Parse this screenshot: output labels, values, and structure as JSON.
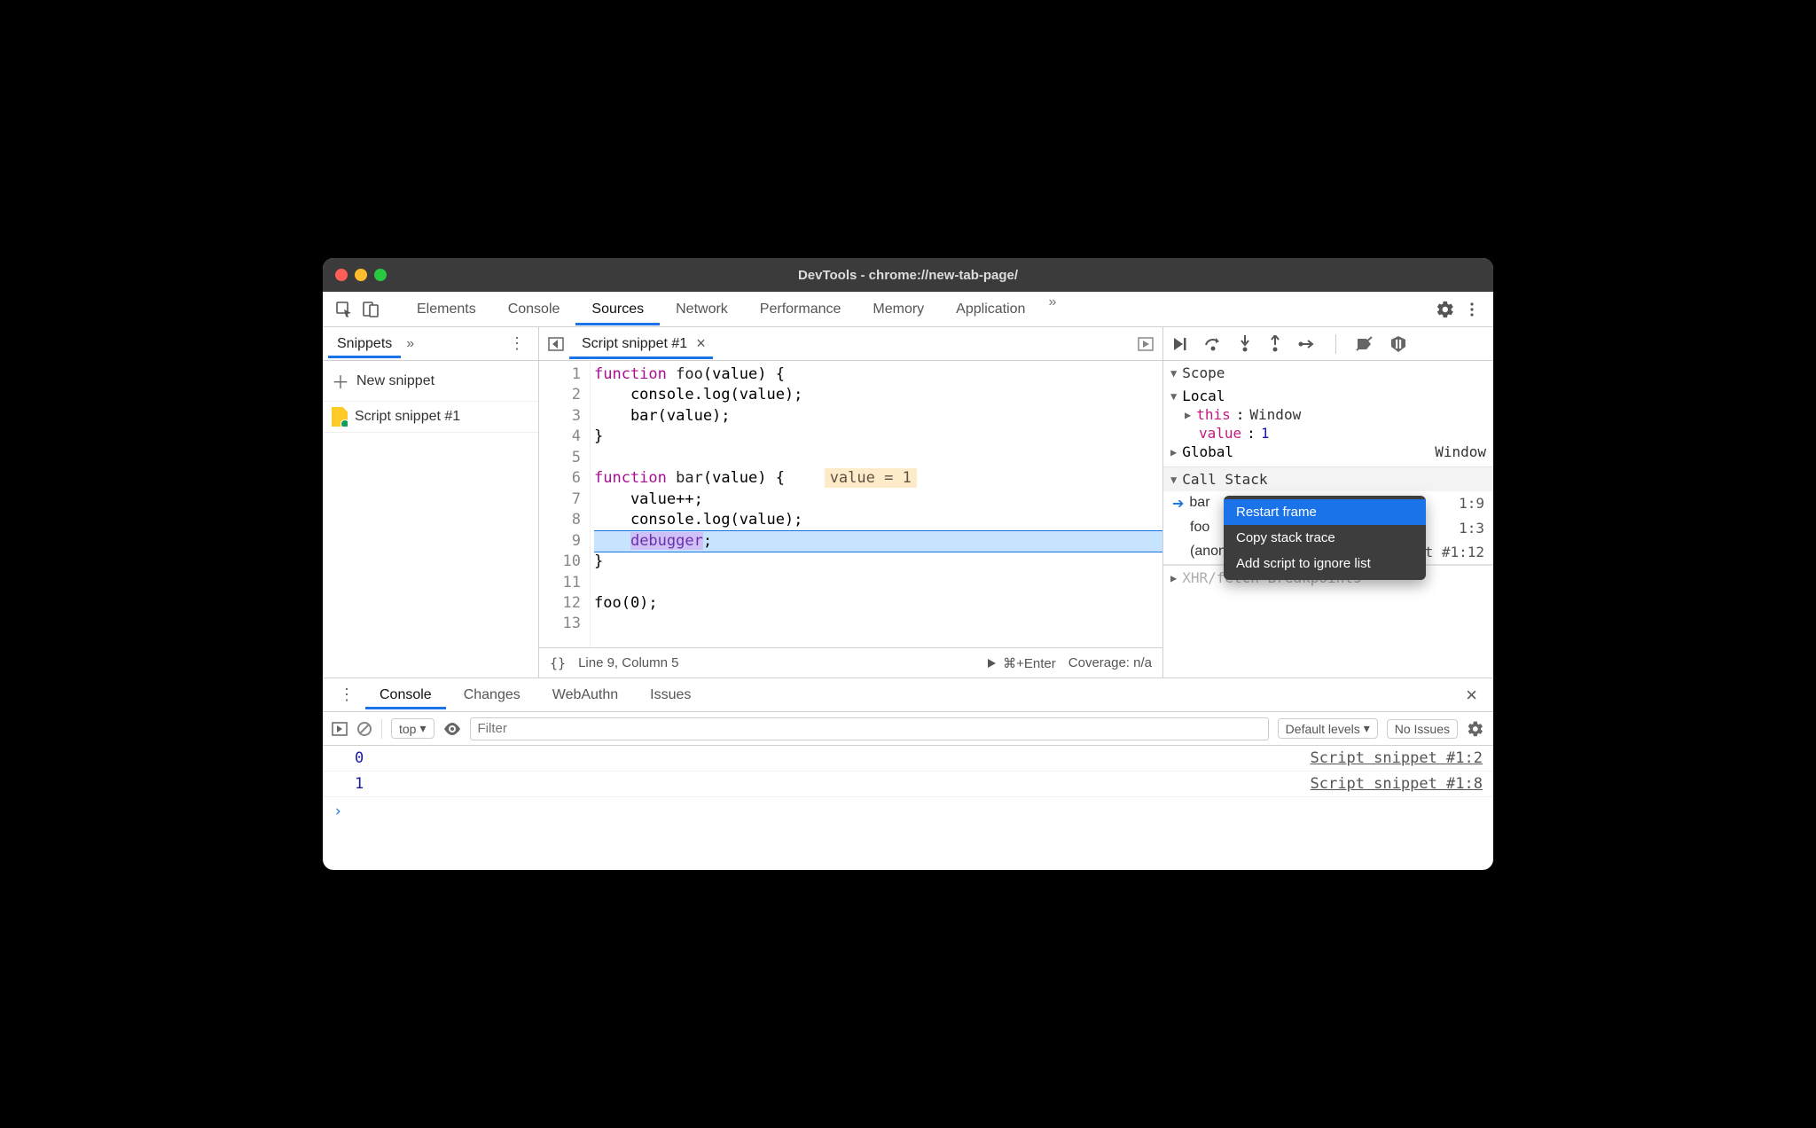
{
  "window": {
    "title": "DevTools - chrome://new-tab-page/"
  },
  "toolbar": {
    "tabs": [
      "Elements",
      "Console",
      "Sources",
      "Network",
      "Performance",
      "Memory",
      "Application"
    ],
    "active": "Sources"
  },
  "sidebar": {
    "activeTab": "Snippets",
    "newSnippetLabel": "New snippet",
    "files": [
      "Script snippet #1"
    ]
  },
  "editor": {
    "activeTab": "Script snippet #1",
    "lines": [
      {
        "n": 1,
        "html": "<span class='kw'>function</span> <span class='fn'>foo</span>(value) {"
      },
      {
        "n": 2,
        "html": "    console.log(value);"
      },
      {
        "n": 3,
        "html": "    bar(value);"
      },
      {
        "n": 4,
        "html": "}"
      },
      {
        "n": 5,
        "html": " "
      },
      {
        "n": 6,
        "html": "<span class='kw'>function</span> <span class='fn'>bar</span>(value) {   <span class='pl-hint'>value = 1</span>"
      },
      {
        "n": 7,
        "html": "    value++;"
      },
      {
        "n": 8,
        "html": "    console.log(value);"
      },
      {
        "n": 9,
        "html": "    <span class='dbgkw'>debugger</span>;",
        "paused": true
      },
      {
        "n": 10,
        "html": "}"
      },
      {
        "n": 11,
        "html": " "
      },
      {
        "n": 12,
        "html": "foo(0);"
      },
      {
        "n": 13,
        "html": " "
      }
    ],
    "status": {
      "cursor": "Line 9, Column 5",
      "run": "⌘+Enter",
      "coverage": "Coverage: n/a"
    }
  },
  "debugger": {
    "scope": {
      "title": "Scope",
      "local": {
        "label": "Local",
        "this": {
          "name": "this",
          "value": "Window"
        },
        "variable": {
          "name": "value",
          "value": "1"
        }
      },
      "global": {
        "label": "Global",
        "value": "Window"
      }
    },
    "callstack": {
      "title": "Call Stack",
      "frames": [
        {
          "name": "bar",
          "loc": "1:9",
          "current": true
        },
        {
          "name": "foo",
          "loc": "1:3"
        },
        {
          "name": "(anonymous)",
          "loc": "Script snippet #1:12",
          "fullLoc": true
        }
      ],
      "next": "XHR/fetch Breakpoints"
    },
    "contextMenu": {
      "items": [
        "Restart frame",
        "Copy stack trace",
        "Add script to ignore list"
      ],
      "selected": "Restart frame"
    }
  },
  "drawer": {
    "tabs": [
      "Console",
      "Changes",
      "WebAuthn",
      "Issues"
    ],
    "active": "Console",
    "filterPlaceholder": "Filter",
    "context": "top",
    "levels": "Default levels",
    "issuesBtn": "No Issues",
    "messages": [
      {
        "text": "0",
        "src": "Script snippet #1:2"
      },
      {
        "text": "1",
        "src": "Script snippet #1:8"
      }
    ]
  }
}
